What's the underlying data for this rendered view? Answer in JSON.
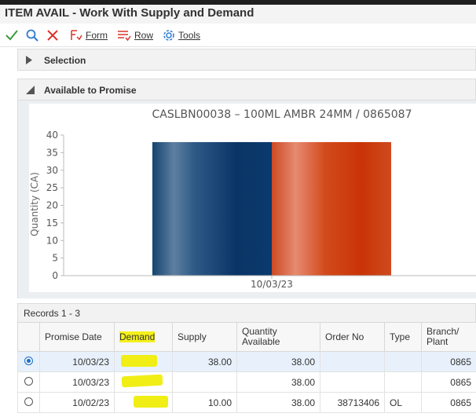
{
  "app": {
    "title": "ITEM AVAIL - Work With Supply and Demand"
  },
  "toolbar": {
    "ok_icon": "check-icon",
    "find_icon": "search-icon",
    "cancel_icon": "close-icon",
    "menus": [
      {
        "label": "Form",
        "icon": "form-menu-icon"
      },
      {
        "label": "Row",
        "icon": "row-menu-icon"
      },
      {
        "label": "Tools",
        "icon": "gear-icon"
      }
    ]
  },
  "sections": {
    "selection": "Selection",
    "available_to_promise": "Available to Promise"
  },
  "chart_data": {
    "type": "bar",
    "title": "CASLBN00038 – 100ML AMBR 24MM / 0865087",
    "ylabel": "Quantity (CA)",
    "xlabel": "",
    "ylim": [
      0,
      40
    ],
    "yticks": [
      0,
      5,
      10,
      15,
      20,
      25,
      30,
      35,
      40
    ],
    "categories": [
      "10/03/23"
    ],
    "series": [
      {
        "values": [
          38
        ],
        "color": "#0d3c6e"
      },
      {
        "values": [
          38
        ],
        "color": "#cc3a0c"
      }
    ]
  },
  "grid": {
    "records_label": "Records 1 - 3",
    "columns": [
      "Promise Date",
      "Demand",
      "Supply",
      "Quantity Available",
      "Order No",
      "Type",
      "Branch/ Plant"
    ],
    "rows": [
      {
        "selected": true,
        "date": "10/03/23",
        "demand": "",
        "supply": "38.00",
        "qty": "38.00",
        "order": "",
        "type": "",
        "branch": "0865"
      },
      {
        "selected": false,
        "date": "10/03/23",
        "demand": "",
        "supply": "",
        "qty": "38.00",
        "order": "",
        "type": "",
        "branch": "0865"
      },
      {
        "selected": false,
        "date": "10/02/23",
        "demand": "",
        "supply": "10.00",
        "qty": "38.00",
        "order": "38713406",
        "type": "OL",
        "branch": "0865"
      }
    ]
  }
}
